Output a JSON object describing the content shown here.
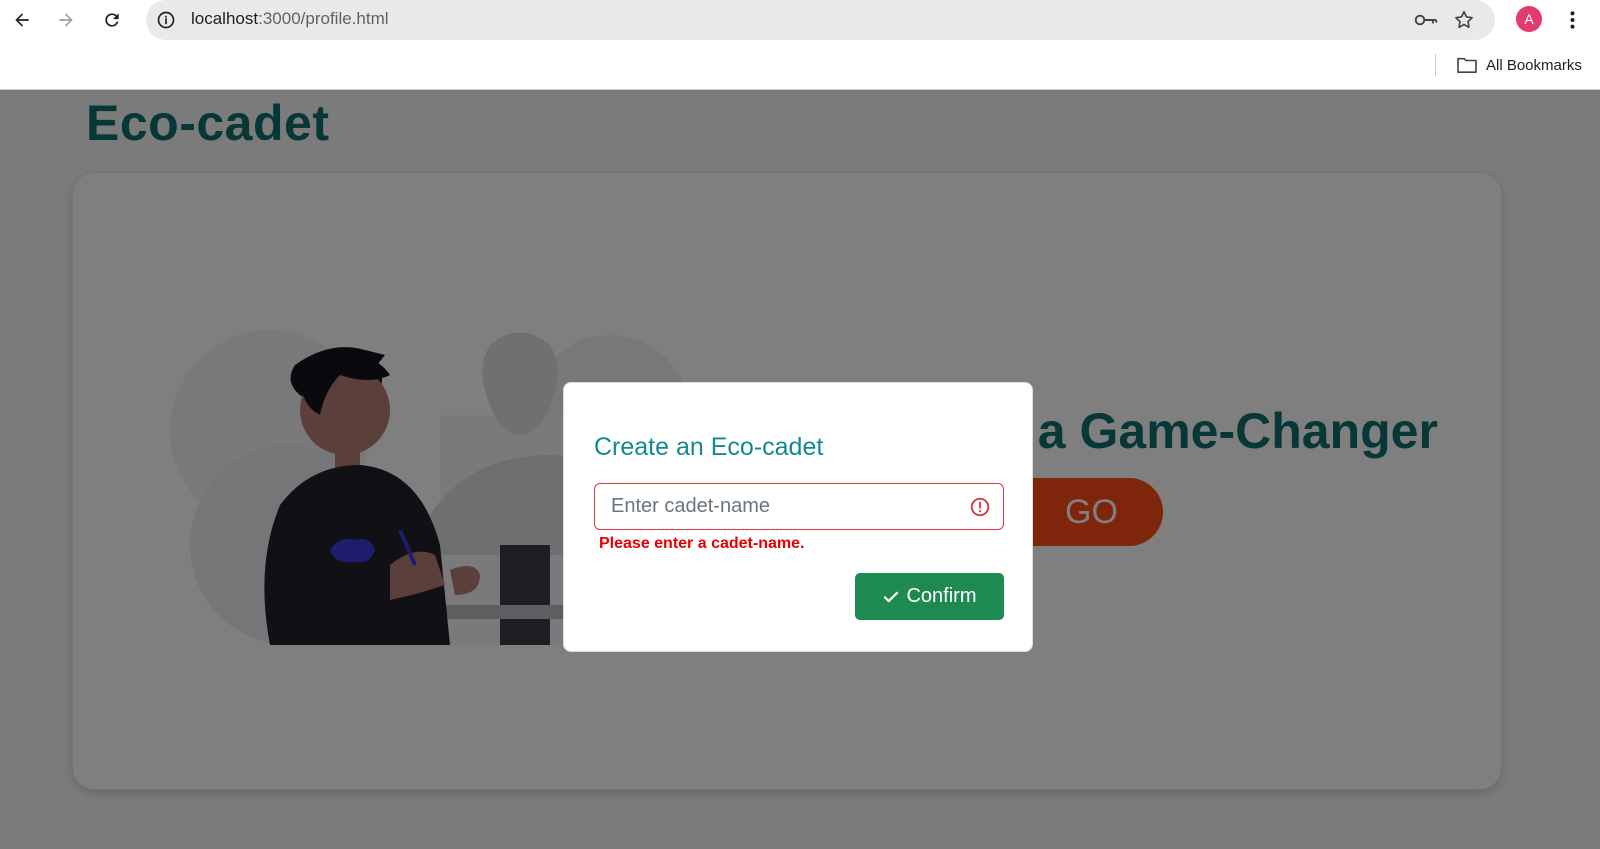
{
  "browser": {
    "url_host": "localhost",
    "url_path": ":3000/profile.html",
    "profile_initial": "A",
    "bookmarks_label": "All Bookmarks"
  },
  "page": {
    "brand": "Eco-cadet",
    "hero_title": "Be a Game-Changer",
    "go_label": "GO"
  },
  "modal": {
    "title": "Create an Eco-cadet",
    "input_placeholder": "Enter cadet-name",
    "input_value": "",
    "error": "Please enter a cadet-name.",
    "confirm_label": "Confirm"
  },
  "colors": {
    "brand": "#0e6f6f",
    "modal_title": "#128a8f",
    "go_button": "#ff4a17",
    "confirm_button": "#1e8a4f",
    "error": "#e60000",
    "overlay": "rgba(0,0,0,0.5)"
  },
  "icons": [
    "back-arrow-icon",
    "forward-arrow-icon",
    "reload-icon",
    "site-info-icon",
    "password-key-icon",
    "bookmark-star-icon",
    "kebab-menu-icon",
    "folder-icon",
    "alert-circle-icon",
    "checkmark-icon"
  ]
}
